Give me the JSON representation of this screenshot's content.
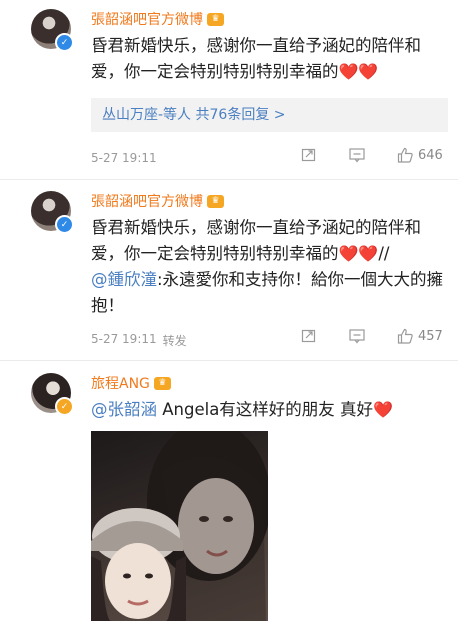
{
  "posts": [
    {
      "author": "張韶涵吧官方微博",
      "text_part1": "昏君新婚快乐，感谢你一直给予涵妃的陪伴和爱，你一定会特别特别特别幸福的",
      "hearts": "❤️❤️",
      "reply_preview_user": "丛山万座-等人",
      "reply_preview_count": "共76条回复 >",
      "time": "5-27 19:11",
      "like_count": "646"
    },
    {
      "author": "張韶涵吧官方微博",
      "text_part1": "昏君新婚快乐，感谢你一直给予涵妃的陪伴和爱，你一定会特别特别特别幸福的",
      "hearts": "❤️❤️",
      "repost_sep": "//",
      "mention": "@鍾欣潼",
      "text_part2": ":永遠愛你和支持你！給你一個大大的擁抱！",
      "time": "5-27 19:11",
      "repost_label": "转发",
      "like_count": "457"
    },
    {
      "author": "旅程ANG",
      "mention": "@张韶涵",
      "text": " Angela有这样好的朋友 真好",
      "heart": "❤️"
    }
  ],
  "icons": {
    "crown": "crown-icon",
    "verified_blue": "verified-badge-icon",
    "verified_gold": "verified-gold-badge-icon",
    "repost": "repost-icon",
    "comment": "comment-icon",
    "like": "like-icon"
  },
  "colors": {
    "name": "#f07a1c",
    "mention": "#4a7fc1",
    "heart": "#e8362f",
    "meta": "#9a9a9a"
  }
}
